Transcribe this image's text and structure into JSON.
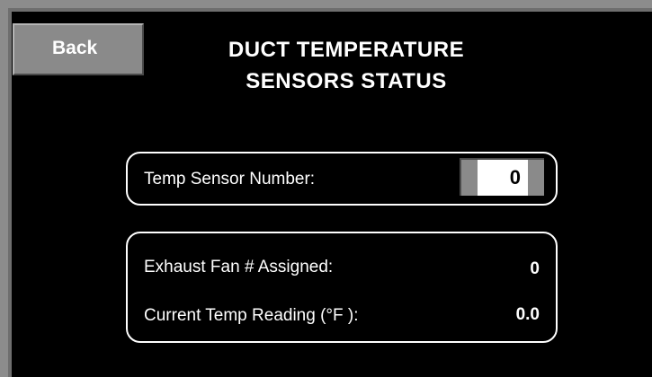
{
  "header": {
    "back_label": "Back",
    "title_line1": "DUCT TEMPERATURE",
    "title_line2": "SENSORS STATUS"
  },
  "sensor_selector": {
    "label": "Temp Sensor Number:",
    "value": "0"
  },
  "status": {
    "exhaust_fan_label": "Exhaust Fan # Assigned:",
    "exhaust_fan_value": "0",
    "temp_reading_label": "Current Temp Reading (°F ):",
    "temp_reading_value": "0.0"
  }
}
